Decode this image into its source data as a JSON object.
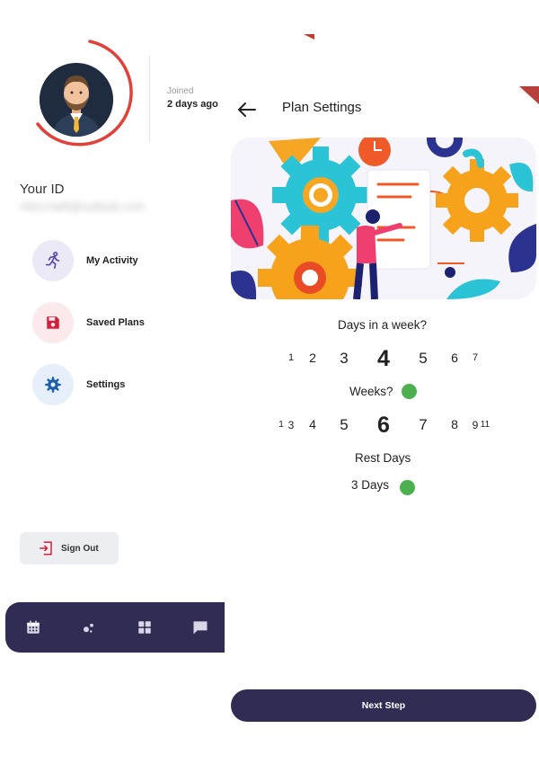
{
  "profile": {
    "joined_label": "Joined",
    "joined_value": "2 days ago",
    "id_label": "Your ID",
    "id_value": "mkrs.haifi@outlook.com"
  },
  "menu": [
    {
      "label": "My Activity",
      "icon": "running-icon",
      "color": "#5b4aa8",
      "bg": "#ece9f6"
    },
    {
      "label": "Saved Plans",
      "icon": "floppy-icon",
      "color": "#d2203a",
      "bg": "#fbe9ec"
    },
    {
      "label": "Settings",
      "icon": "gear-icon",
      "color": "#1f5fa8",
      "bg": "#e7f0fa"
    }
  ],
  "sign_out_label": "Sign Out",
  "bottom_nav": [
    "calendar-icon",
    "dots-icon",
    "grid-icon",
    "chat-icon"
  ],
  "plan": {
    "title": "Plan Settings",
    "days_label": "Days in a week?",
    "days_options": [
      "1",
      "2",
      "3",
      "4",
      "5",
      "6",
      "7"
    ],
    "days_selected": "4",
    "weeks_label": "Weeks?",
    "weeks_options": [
      "1",
      "3",
      "4",
      "5",
      "6",
      "7",
      "8",
      "9",
      "11"
    ],
    "weeks_selected": "6",
    "rest_label": "Rest Days",
    "rest_value": "3 Days",
    "next_label": "Next Step"
  },
  "colors": {
    "accent": "#302c53",
    "ring": "#e0413a",
    "toggle": "#4caf50"
  }
}
